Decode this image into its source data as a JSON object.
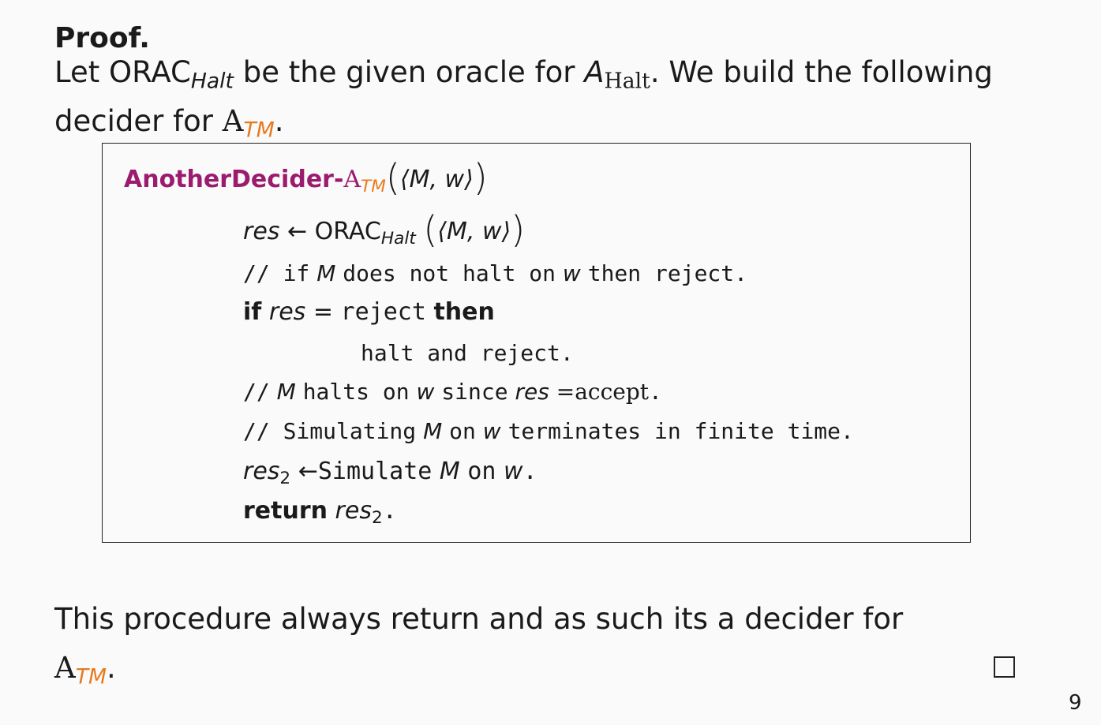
{
  "proof_heading": "Proof.",
  "intro": {
    "let": "Let",
    "orac": "ORAC",
    "orac_sub": "Halt",
    "be_given": "be the given oracle for",
    "a_letter": "A",
    "a_halt_sub": "Halt",
    "build": ". We build the following",
    "decider_for": "decider for",
    "atm_letter": "A",
    "atm_sub": "TM",
    "period": "."
  },
  "algorithm": {
    "name": "AnotherDecider-",
    "name_a": "A",
    "name_sub": "TM",
    "input": "⟨M, w⟩",
    "lines": {
      "res": "res",
      "arrow": "←",
      "orac": "ORAC",
      "orac_sub": "Halt",
      "comment1_a": "// if",
      "m": "M",
      "comment1_b": "does not halt on",
      "w": "w",
      "comment1_c": "then reject.",
      "if_kw": "if",
      "eq": "=",
      "reject": "reject",
      "then_kw": "then",
      "halt_reject": "halt and reject.",
      "comment2_a": "//",
      "comment2_b": "halts on",
      "comment2_c": "since",
      "accept": "accept",
      "comment3_a": "// Simulating",
      "comment3_b": "on",
      "comment3_c": "terminates in finite time.",
      "res2": "res",
      "res2_sub": "2",
      "simulate": "Simulate",
      "on": "on",
      "return_kw": "return",
      "dot": "."
    }
  },
  "conclusion": {
    "line1": "This procedure always return and as such its a decider for",
    "atm_letter": "A",
    "atm_sub": "TM",
    "period": "."
  },
  "page_number": "9"
}
